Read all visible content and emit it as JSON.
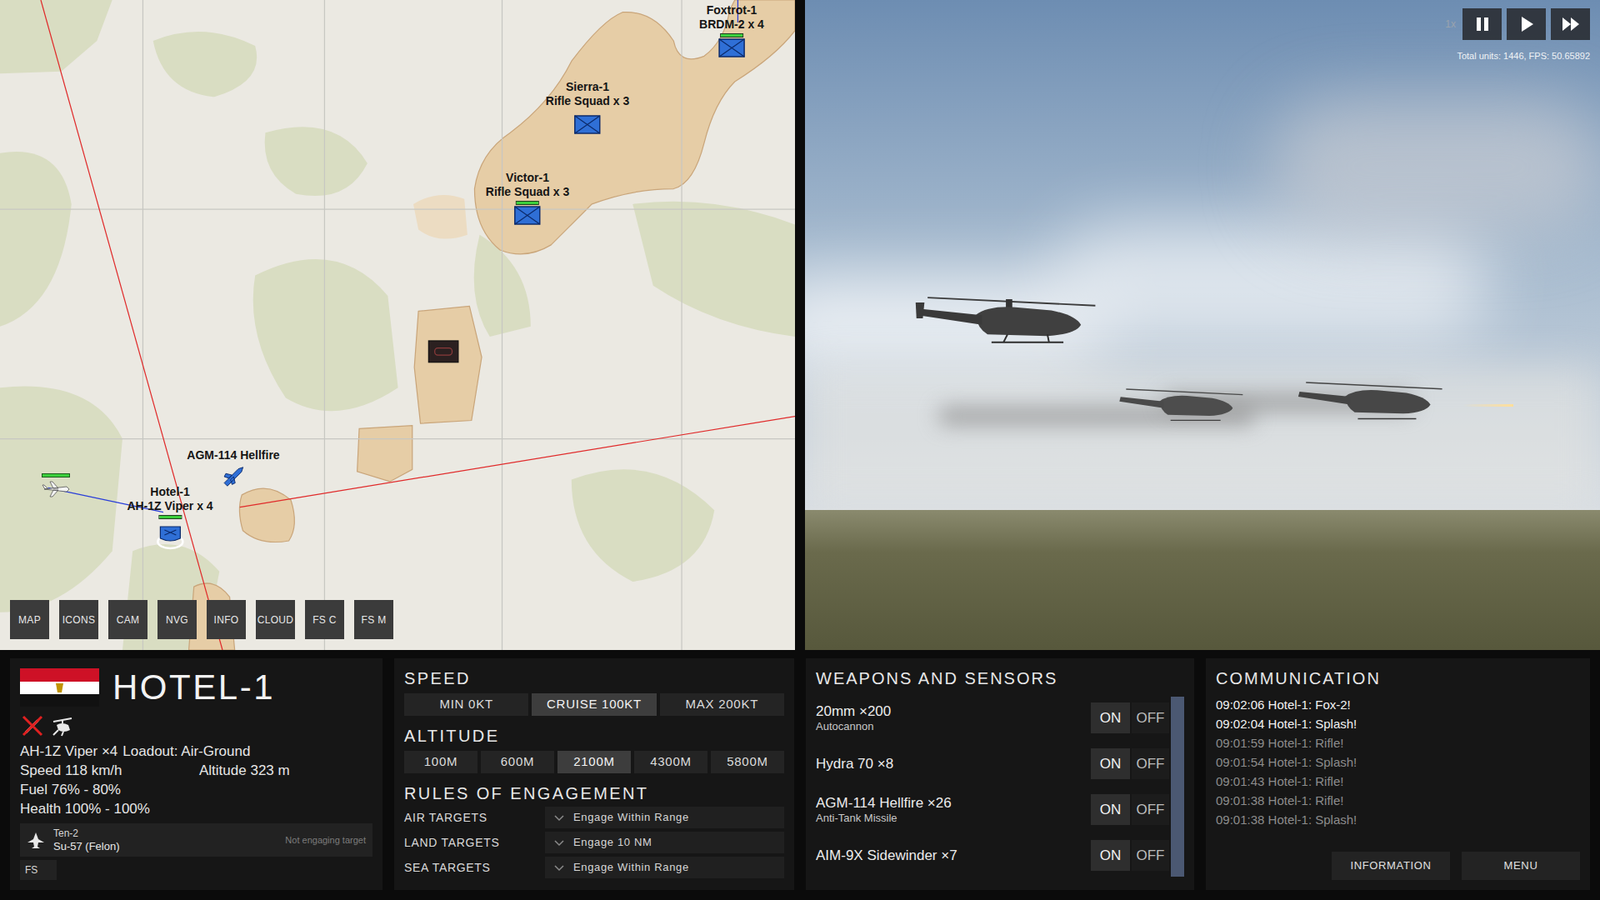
{
  "map": {
    "markers": [
      {
        "name": "Foxtrot-1",
        "detail": "BRDM-2 x 4",
        "kind": "ground",
        "health_shown": true,
        "health": 1
      },
      {
        "name": "Sierra-1",
        "detail": "Rifle Squad x 3",
        "kind": "ground",
        "health_shown": false,
        "health": 1
      },
      {
        "name": "Victor-1",
        "detail": "Rifle Squad x 3",
        "kind": "ground",
        "health_shown": true,
        "health": 1
      },
      {
        "name": "Hotel-1",
        "detail": "AH-1Z Viper x 4",
        "kind": "air",
        "health_shown": true,
        "health": 1
      }
    ],
    "missile": {
      "label": "AGM-114 Hellfire"
    },
    "buttons": [
      "MAP",
      "ICONS",
      "CAM",
      "NVG",
      "INFO",
      "CLOUD",
      "FS C",
      "FS M"
    ]
  },
  "view": {
    "speed": "1x",
    "controls": [
      {
        "kind": "pause"
      },
      {
        "kind": "play"
      },
      {
        "kind": "fast"
      }
    ],
    "stats": "Total units: 1446, FPS: 50.65892"
  },
  "unit": {
    "name": "HOTEL-1",
    "type": "AH-1Z Viper ×4",
    "loadout": "Loadout: Air-Ground",
    "speed": "Speed 118 km/h",
    "altitude": "Altitude 323 m",
    "fuel": "Fuel 76% - 80%",
    "health": "Health 100% - 100%",
    "target": {
      "callsign": "Ten-2",
      "type": "Su-57 (Felon)",
      "status": "Not engaging target"
    },
    "fs": "FS"
  },
  "speed": {
    "title": "SPEED",
    "options": [
      {
        "label": "MIN 0KT",
        "selected": false
      },
      {
        "label": "CRUISE 100KT",
        "selected": true
      },
      {
        "label": "MAX 200KT",
        "selected": false
      }
    ]
  },
  "altitude": {
    "title": "ALTITUDE",
    "options": [
      {
        "label": "100M",
        "selected": false
      },
      {
        "label": "600M",
        "selected": false
      },
      {
        "label": "2100M",
        "selected": true
      },
      {
        "label": "4300M",
        "selected": false
      },
      {
        "label": "5800M",
        "selected": false
      }
    ]
  },
  "roe": {
    "title": "RULES OF ENGAGEMENT",
    "rows": [
      {
        "label": "AIR TARGETS",
        "value": "Engage Within Range"
      },
      {
        "label": "LAND TARGETS",
        "value": "Engage 10 NM"
      },
      {
        "label": "SEA TARGETS",
        "value": "Engage Within Range"
      }
    ]
  },
  "weapons": {
    "title": "WEAPONS AND SENSORS",
    "on_label": "ON",
    "off_label": "OFF",
    "scroll": {
      "level": 1
    },
    "items": [
      {
        "name": "20mm ×200",
        "sub": "Autocannon",
        "on": true
      },
      {
        "name": "Hydra 70 ×8",
        "sub": "",
        "on": true
      },
      {
        "name": "AGM-114 Hellfire ×26",
        "sub": "Anti-Tank Missile",
        "on": true
      },
      {
        "name": "AIM-9X Sidewinder ×7",
        "sub": "",
        "on": true
      }
    ]
  },
  "comms": {
    "title": "COMMUNICATION",
    "messages": [
      {
        "text": "09:02:06 Hotel-1: Fox-2!",
        "recent": true
      },
      {
        "text": "09:02:04 Hotel-1: Splash!",
        "recent": true
      },
      {
        "text": "09:01:59 Hotel-1: Rifle!",
        "recent": false
      },
      {
        "text": "09:01:54 Hotel-1: Splash!",
        "recent": false
      },
      {
        "text": "09:01:43 Hotel-1: Rifle!",
        "recent": false
      },
      {
        "text": "09:01:38 Hotel-1: Rifle!",
        "recent": false
      },
      {
        "text": "09:01:38 Hotel-1: Splash!",
        "recent": false
      }
    ],
    "buttons": [
      "INFORMATION",
      "MENU"
    ]
  }
}
